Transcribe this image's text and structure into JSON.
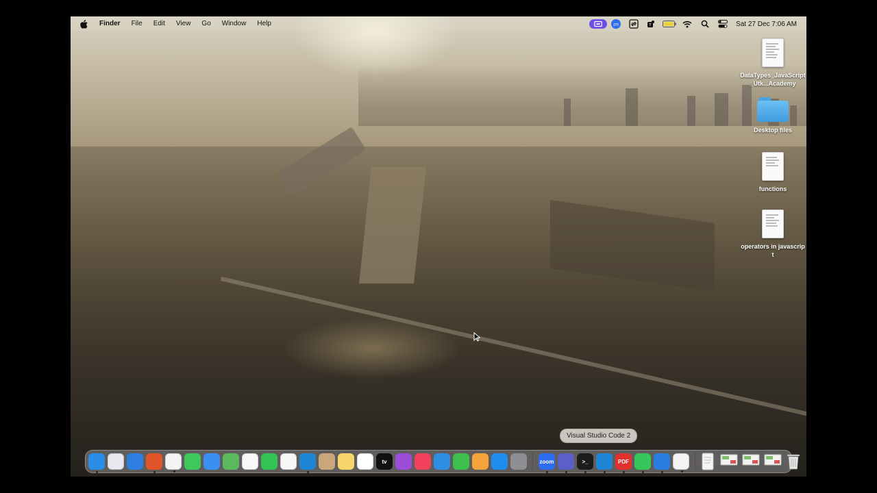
{
  "menubar": {
    "apple_icon": "apple-logo-icon",
    "app_name": "Finder",
    "menus": [
      "File",
      "Edit",
      "View",
      "Go",
      "Window",
      "Help"
    ],
    "status_icons": [
      "screen-record-icon",
      "zoom-icon",
      "sync-icon",
      "teams-icon",
      "battery-icon",
      "wifi-icon",
      "spotlight-search-icon",
      "control-center-icon"
    ],
    "clock": "Sat 27 Dec  7:06 AM"
  },
  "desktop": {
    "items": [
      {
        "label": "DataTypes_JavaScript_Utk...Academy",
        "icon": "document-icon"
      },
      {
        "label": "Desktop files",
        "icon": "folder-icon"
      },
      {
        "label": "functions",
        "icon": "document-icon"
      },
      {
        "label": "operators in javascript",
        "icon": "document-icon"
      }
    ]
  },
  "tooltip": "Visual Studio Code 2",
  "dock": {
    "apps": [
      {
        "name": "finder-icon",
        "glyph": "",
        "color": "#2a8ee8",
        "running": true
      },
      {
        "name": "launchpad-icon",
        "glyph": "",
        "color": "#e8e8ee",
        "running": false
      },
      {
        "name": "safari-icon",
        "glyph": "",
        "color": "#2e7ee0",
        "running": false
      },
      {
        "name": "firefox-icon",
        "glyph": "",
        "color": "#e2552a",
        "running": true
      },
      {
        "name": "chrome-icon",
        "glyph": "",
        "color": "#f4f4f4",
        "running": true
      },
      {
        "name": "messages-icon",
        "glyph": "",
        "color": "#3cc85a",
        "running": false
      },
      {
        "name": "mail-icon",
        "glyph": "",
        "color": "#3a8ff0",
        "running": false
      },
      {
        "name": "maps-icon",
        "glyph": "",
        "color": "#5cb85c",
        "running": false
      },
      {
        "name": "photos-icon",
        "glyph": "",
        "color": "#f8f8f8",
        "running": false
      },
      {
        "name": "facetime-icon",
        "glyph": "",
        "color": "#32c553",
        "running": false
      },
      {
        "name": "reminders-icon",
        "glyph": "",
        "color": "#f7f7f7",
        "running": false
      },
      {
        "name": "vscode-icon",
        "glyph": "",
        "color": "#1f86d6",
        "running": true
      },
      {
        "name": "contacts-icon",
        "glyph": "",
        "color": "#c9a77a",
        "running": false
      },
      {
        "name": "notes-icon",
        "glyph": "",
        "color": "#f7d56a",
        "running": false
      },
      {
        "name": "freeform-icon",
        "glyph": "",
        "color": "#ffffff",
        "running": false
      },
      {
        "name": "apple-tv-icon",
        "glyph": "tv",
        "color": "#111111",
        "running": false
      },
      {
        "name": "podcasts-icon",
        "glyph": "",
        "color": "#9b4dd8",
        "running": false
      },
      {
        "name": "music-icon",
        "glyph": "",
        "color": "#f1405a",
        "running": false
      },
      {
        "name": "keynote-icon",
        "glyph": "",
        "color": "#2f8de4",
        "running": false
      },
      {
        "name": "numbers-icon",
        "glyph": "",
        "color": "#3cbf4c",
        "running": false
      },
      {
        "name": "pages-icon",
        "glyph": "",
        "color": "#f4a23a",
        "running": false
      },
      {
        "name": "app-store-icon",
        "glyph": "",
        "color": "#1f8cf0",
        "running": false
      },
      {
        "name": "system-settings-icon",
        "glyph": "",
        "color": "#8e8e93",
        "running": false
      }
    ],
    "recent_apps": [
      {
        "name": "zoom-icon",
        "glyph": "zoom",
        "color": "#2d6cf0",
        "running": true
      },
      {
        "name": "teams-icon",
        "glyph": "",
        "color": "#5b5fc7",
        "running": true
      },
      {
        "name": "terminal-icon",
        "glyph": ">_",
        "color": "#1c1c1c",
        "running": true
      },
      {
        "name": "vscode-2-icon",
        "glyph": "",
        "color": "#1f86d6",
        "running": true
      },
      {
        "name": "pdf-reader-icon",
        "glyph": "PDF",
        "color": "#e0312f",
        "running": true
      },
      {
        "name": "whatsapp-icon",
        "glyph": "",
        "color": "#35c75a",
        "running": true
      },
      {
        "name": "quicktime-icon",
        "glyph": "",
        "color": "#2a7de0",
        "running": true
      },
      {
        "name": "textedit-icon",
        "glyph": "",
        "color": "#f4f4f4",
        "running": true
      }
    ],
    "stack_items": [
      "downloads-document-icon",
      "screenshot-stack-icon",
      "screenshot-stack-2-icon",
      "screenshot-stack-3-icon"
    ],
    "trash": "trash-icon"
  }
}
